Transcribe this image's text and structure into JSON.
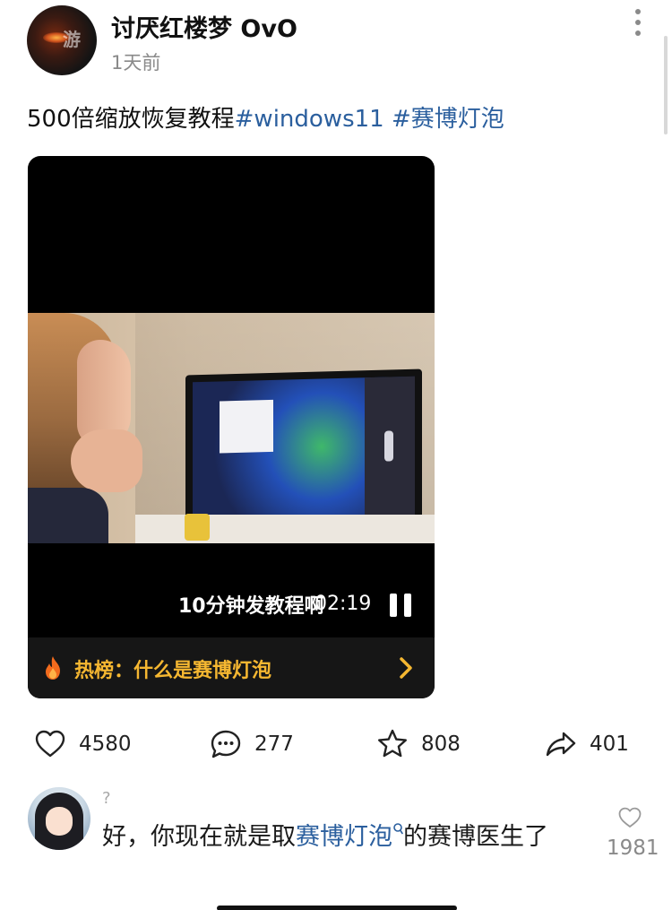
{
  "post": {
    "username": "讨厌红楼梦 OvO",
    "time": "1天前",
    "avatar_watermark": "游",
    "text": "500倍缩放恢复教程",
    "hashtags": [
      "#windows11",
      "#赛博灯泡"
    ]
  },
  "video": {
    "caption": "10分钟发教程啊",
    "duration": "02:19",
    "hot_label": "热榜：什么是赛博灯泡"
  },
  "actions": {
    "likes": "4580",
    "comments": "277",
    "favorites": "808",
    "shares": "401"
  },
  "comment": {
    "username": "?",
    "text_before": "好，你现在就是取",
    "link": "赛博灯泡",
    "text_after": "的赛博医生了",
    "like_count": "1981"
  },
  "icons": {
    "more": "more-vertical-icon",
    "pause": "pause-icon",
    "fire": "fire-icon",
    "chevron": "chevron-right-icon",
    "like": "heart-icon",
    "comment": "comment-bubble-icon",
    "favorite": "star-icon",
    "share": "share-arrow-icon",
    "search": "search-icon"
  },
  "colors": {
    "hashtag": "#2b5f9e",
    "hot_text": "#f5b731",
    "secondary_text": "#8a8a8a"
  }
}
